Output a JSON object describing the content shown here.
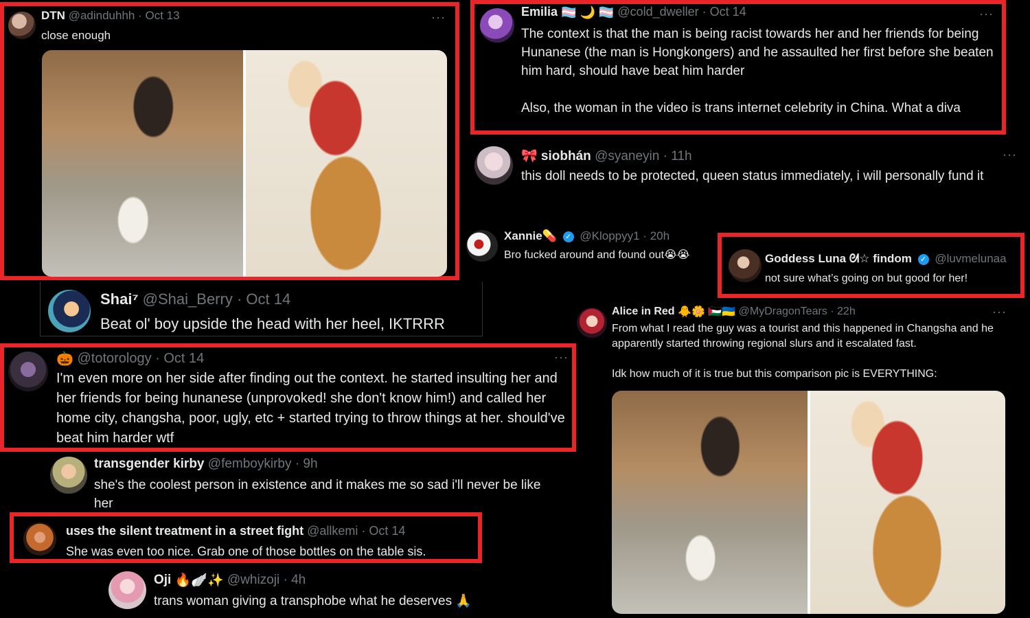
{
  "posts": {
    "dtn": {
      "name": "DTN",
      "handle": "@adinduhhh · Oct 13",
      "text": "close enough"
    },
    "emilia": {
      "name": "Emilia",
      "emojis": "🏳️‍⚧️ 🌙 🏳️‍⚧️",
      "handle": "@cold_dweller · Oct 14",
      "text1": "The context is that the man is being racist towards her and her friends for being Hunanese (the man is Hongkongers) and he assaulted her first before she beaten him hard, should have beat him harder",
      "text2": "Also, the woman in the video is trans internet celebrity in China. What a diva"
    },
    "siobhan": {
      "name": "🎀 siobhán",
      "handle": "@syaneyin · 11h",
      "text": "this doll needs to be protected, queen status immediately, i will personally fund it"
    },
    "xannie": {
      "name": "Xannie💊",
      "handle": "@Kloppyy1 · 20h",
      "text": "Bro fucked around and found out😭😭"
    },
    "luna": {
      "name": "Goddess Luna ᘛ☆ findom",
      "handle": "@luvmelunaa",
      "text": "not sure what’s going on but good for her!"
    },
    "shai": {
      "name": "Shai⁷",
      "handle": "@Shai_Berry · Oct 14",
      "text": "Beat ol' boy upside the head with her heel, IKTRRR"
    },
    "alice": {
      "name": "Alice in Red",
      "emojis": "🐥🌼 🇵🇸🇺🇦",
      "handle": "@MyDragonTears · 22h",
      "text1": "From what I read the guy was a tourist and this happened in Changsha and he apparently started throwing regional slurs and it escalated fast.",
      "text2": "Idk how much of it is true but this comparison pic is EVERYTHING:"
    },
    "totorology": {
      "emoji": "🎃",
      "handle": "@totorology · Oct 14",
      "text": "I'm even more on her side after finding out the context. he started insulting her and her friends for being hunanese (unprovoked! she don't know him!) and called her home city, changsha, poor, ugly, etc + started trying to throw things at her. should've beat him harder  wtf"
    },
    "kirby": {
      "name": "transgender kirby",
      "handle": "@femboykirby · 9h",
      "text": "she's the coolest person in existence and it makes me so sad i'll never be like her"
    },
    "allkemi": {
      "name": "uses the silent treatment in a street fight",
      "handle": "@allkemi · Oct 14",
      "text": "She was even too nice. Grab one of those bottles on the table sis."
    },
    "oji": {
      "name": "Oji",
      "emojis": "🔥🪽✨",
      "handle": "@whizoji · 4h",
      "text": "trans woman giving a transphobe what he deserves 🙏"
    }
  },
  "more_icon_label": "···",
  "verified_icon_glyph": "✓",
  "colors": {
    "highlight": "#e8262a",
    "background": "#000000",
    "handle": "#71767b",
    "verified": "#1d9bf0"
  }
}
